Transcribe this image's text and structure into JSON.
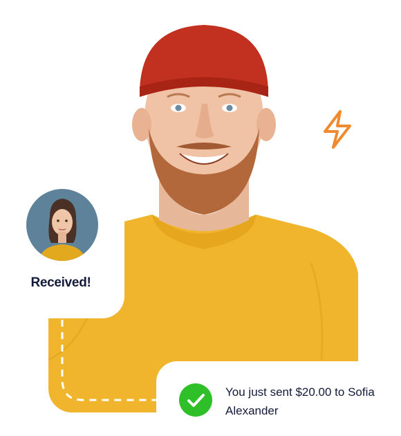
{
  "received": {
    "label": "Received!"
  },
  "notification": {
    "message": "You just sent $20.00 to Sofia Alexander"
  },
  "icons": {
    "avatar": "woman-avatar",
    "status": "checkmark-icon",
    "decoration": "lightning-bolt-icon"
  },
  "colors": {
    "sweater": "#f0b52c",
    "beanie": "#c2301f",
    "avatar_bg": "#5d8299",
    "check": "#2fbf28",
    "bolt": "#f18a2f",
    "text": "#131a3a"
  }
}
